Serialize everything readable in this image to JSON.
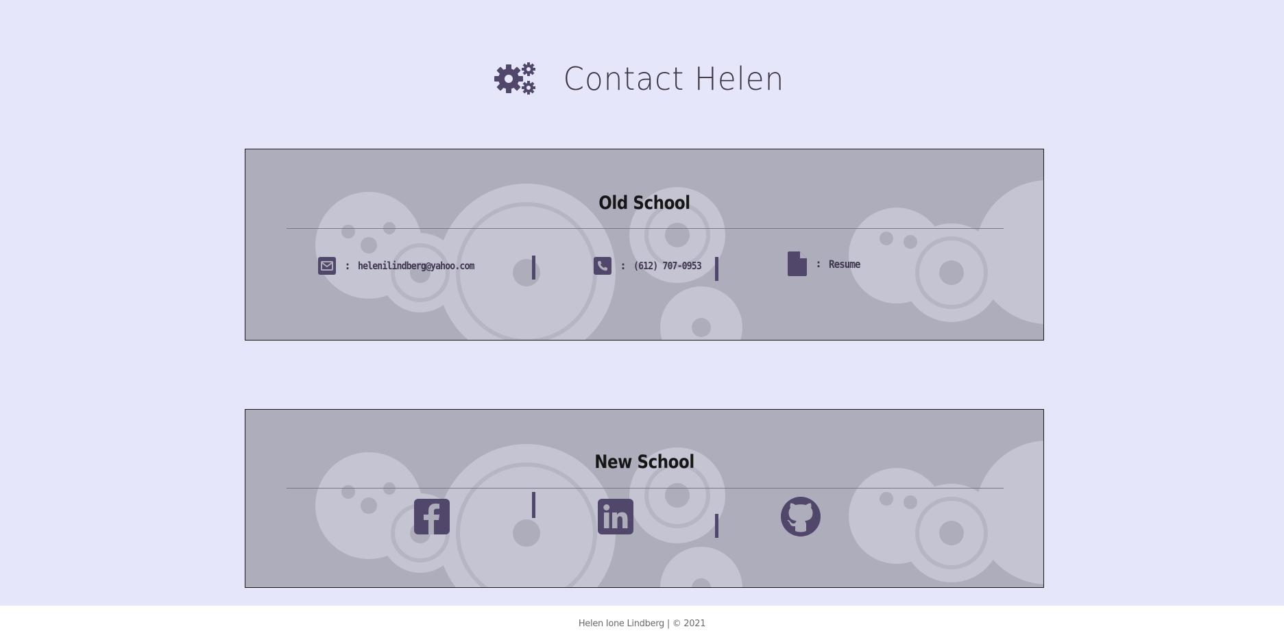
{
  "header": {
    "title": "Contact Helen",
    "icon": "gears-icon"
  },
  "old_school": {
    "title": "Old School",
    "email": {
      "icon": "envelope-icon",
      "separator": ":",
      "text": "helenilindberg@yahoo.com"
    },
    "phone": {
      "icon": "phone-icon",
      "separator": ":",
      "text": "(612) 707-0953"
    },
    "resume": {
      "icon": "file-icon",
      "separator": ":",
      "text": "Resume"
    }
  },
  "new_school": {
    "title": "New School",
    "links": [
      {
        "icon": "facebook-icon"
      },
      {
        "icon": "linkedin-icon"
      },
      {
        "icon": "github-icon"
      }
    ]
  },
  "footer": {
    "text": "Helen Ione Lindberg | © 2021"
  },
  "colors": {
    "page_background": "#e6e6fa",
    "card_background": "#aeadbb",
    "icon_purple": "#51476a",
    "text_dark": "#161616"
  }
}
